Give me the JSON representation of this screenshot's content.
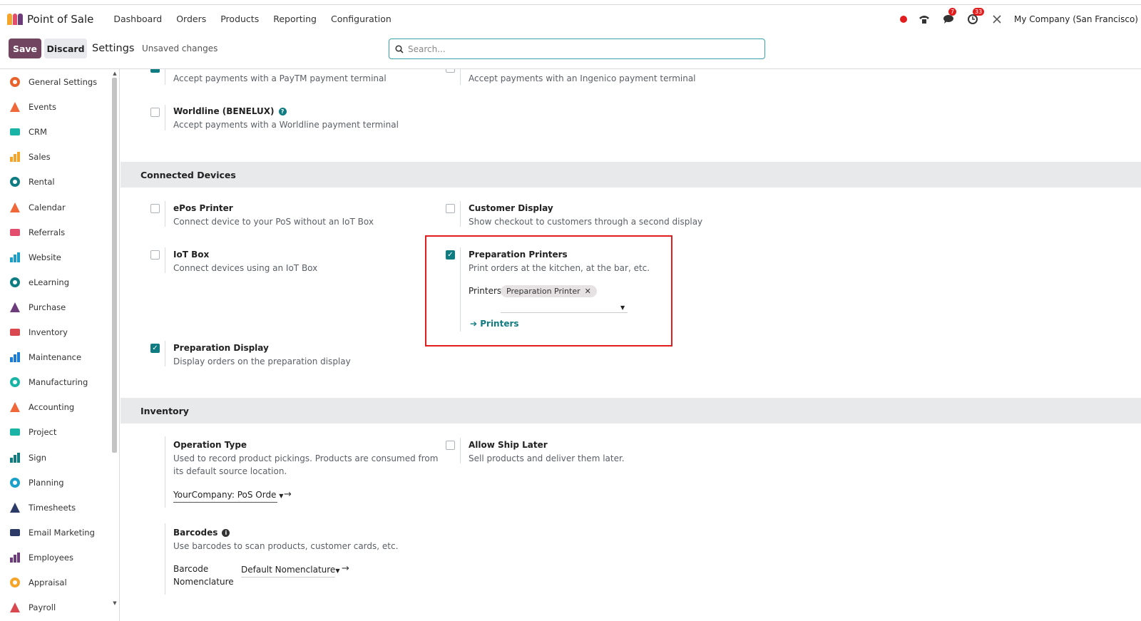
{
  "topbar": {
    "app_name": "Point of Sale",
    "nav": [
      "Dashboard",
      "Orders",
      "Products",
      "Reporting",
      "Configuration"
    ],
    "chat_badge": "7",
    "activity_badge": "33",
    "company": "My Company (San Francisco)"
  },
  "controlbar": {
    "save_label": "Save",
    "discard_label": "Discard",
    "title": "Settings",
    "status": "Unsaved changes",
    "search_placeholder": "Search..."
  },
  "sidebar": {
    "items": [
      {
        "label": "General Settings",
        "icon": "general-settings-icon",
        "color": "#e8632b"
      },
      {
        "label": "Events",
        "icon": "events-icon",
        "color": "#f0683a"
      },
      {
        "label": "CRM",
        "icon": "crm-icon",
        "color": "#1ab4a6"
      },
      {
        "label": "Sales",
        "icon": "sales-icon",
        "color": "#f4a52a"
      },
      {
        "label": "Rental",
        "icon": "rental-icon",
        "color": "#0f7c82"
      },
      {
        "label": "Calendar",
        "icon": "calendar-icon",
        "color": "#f0683a"
      },
      {
        "label": "Referrals",
        "icon": "referrals-icon",
        "color": "#e24d6e"
      },
      {
        "label": "Website",
        "icon": "website-icon",
        "color": "#1aa0c9"
      },
      {
        "label": "eLearning",
        "icon": "elearning-icon",
        "color": "#0f7c82"
      },
      {
        "label": "Purchase",
        "icon": "purchase-icon",
        "color": "#6c3d7a"
      },
      {
        "label": "Inventory",
        "icon": "inventory-icon",
        "color": "#d9474f"
      },
      {
        "label": "Maintenance",
        "icon": "maintenance-icon",
        "color": "#1a7dd8"
      },
      {
        "label": "Manufacturing",
        "icon": "manufacturing-icon",
        "color": "#1ab4a6"
      },
      {
        "label": "Accounting",
        "icon": "accounting-icon",
        "color": "#f0683a"
      },
      {
        "label": "Project",
        "icon": "project-icon",
        "color": "#1ab4a6"
      },
      {
        "label": "Sign",
        "icon": "sign-icon",
        "color": "#0f7c82"
      },
      {
        "label": "Planning",
        "icon": "planning-icon",
        "color": "#1aa0c9"
      },
      {
        "label": "Timesheets",
        "icon": "timesheets-icon",
        "color": "#2b3a67"
      },
      {
        "label": "Email Marketing",
        "icon": "email-marketing-icon",
        "color": "#2b3a67"
      },
      {
        "label": "Employees",
        "icon": "employees-icon",
        "color": "#6c3d7a"
      },
      {
        "label": "Appraisal",
        "icon": "appraisal-icon",
        "color": "#f4a52a"
      },
      {
        "label": "Payroll",
        "icon": "payroll-icon",
        "color": "#d9474f"
      }
    ]
  },
  "payments": {
    "paytm_desc": "Accept payments with a PayTM payment terminal",
    "ingenico_desc": "Accept payments with an Ingenico payment terminal",
    "worldline_title": "Worldline (BENELUX)",
    "worldline_desc": "Accept payments with a Worldline payment terminal"
  },
  "connected_devices": {
    "heading": "Connected Devices",
    "epos_title": "ePos Printer",
    "epos_desc": "Connect device to your PoS without an IoT Box",
    "customer_display_title": "Customer Display",
    "customer_display_desc": "Show checkout to customers through a second display",
    "iot_title": "IoT Box",
    "iot_desc": "Connect devices using an IoT Box",
    "prep_printers_title": "Preparation Printers",
    "prep_printers_desc": "Print orders at the kitchen, at the bar, etc.",
    "printers_label": "Printers",
    "printer_tag": "Preparation Printer",
    "printers_link": "Printers",
    "prep_display_title": "Preparation Display",
    "prep_display_desc": "Display orders on the preparation display"
  },
  "inventory": {
    "heading": "Inventory",
    "op_type_title": "Operation Type",
    "op_type_desc_1": "Used to record product pickings. Products are consumed from",
    "op_type_desc_2": "its default source location.",
    "op_type_value": "YourCompany: PoS Orde",
    "ship_later_title": "Allow Ship Later",
    "ship_later_desc": "Sell products and deliver them later.",
    "barcodes_title": "Barcodes",
    "barcodes_desc": "Use barcodes to scan products, customer cards, etc.",
    "barcode_label_1": "Barcode",
    "barcode_label_2": "Nomenclature",
    "barcode_value": "Default Nomenclature"
  }
}
